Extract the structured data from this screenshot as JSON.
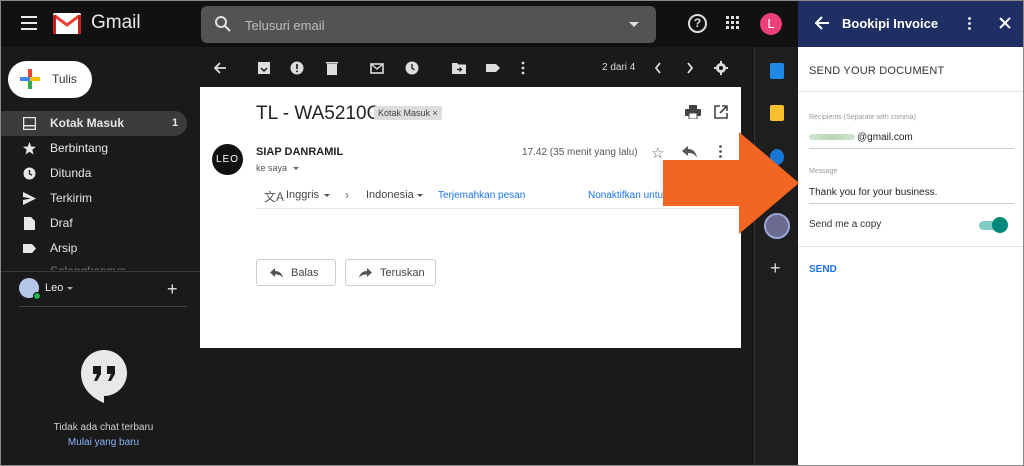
{
  "header": {
    "brand": "Gmail",
    "search_placeholder": "Telusuri email",
    "avatar_letter": "L"
  },
  "sidebar": {
    "compose_label": "Tulis",
    "items": [
      {
        "label": "Kotak Masuk",
        "count": "1",
        "icon": "inbox-icon"
      },
      {
        "label": "Berbintang",
        "icon": "star-icon"
      },
      {
        "label": "Ditunda",
        "icon": "clock-icon"
      },
      {
        "label": "Terkirim",
        "icon": "send-icon"
      },
      {
        "label": "Draf",
        "icon": "draft-icon"
      },
      {
        "label": "Arsip",
        "icon": "label-icon"
      },
      {
        "label": "Selengkapnya"
      }
    ]
  },
  "hangouts": {
    "user": "Leo",
    "no_chat": "Tidak ada chat terbaru",
    "start_new": "Mulai yang baru"
  },
  "toolbar": {
    "pager": "2 dari 4"
  },
  "email": {
    "subject": "TL - WA5210G",
    "label_tag": "Kotak Masuk ×",
    "sender_avatar": "LEO",
    "sender": "SIAP DANRAMIL",
    "to": "ke saya",
    "time": "17.42 (35 menit yang lalu)",
    "translate": {
      "from_lang": "Inggris",
      "to_lang": "Indonesia",
      "translate_link": "Terjemahkan pesan",
      "disable_link": "Nonaktifkan untuk"
    },
    "reply_label": "Balas",
    "forward_label": "Teruskan"
  },
  "panel": {
    "title": "Bookipi Invoice",
    "heading": "SEND YOUR DOCUMENT",
    "recipients_label": "Recipients (Separate with comma)",
    "recipients_value": "@gmail.com",
    "message_label": "Message",
    "message_value": "Thank you for your business.",
    "copy_label": "Send me a copy",
    "copy_enabled": true,
    "send_label": "SEND"
  },
  "colors": {
    "panel_header": "#1f2f63",
    "callout_arrow": "#f26522",
    "toggle_on": "#00897b",
    "link_blue": "#1a73e8"
  }
}
